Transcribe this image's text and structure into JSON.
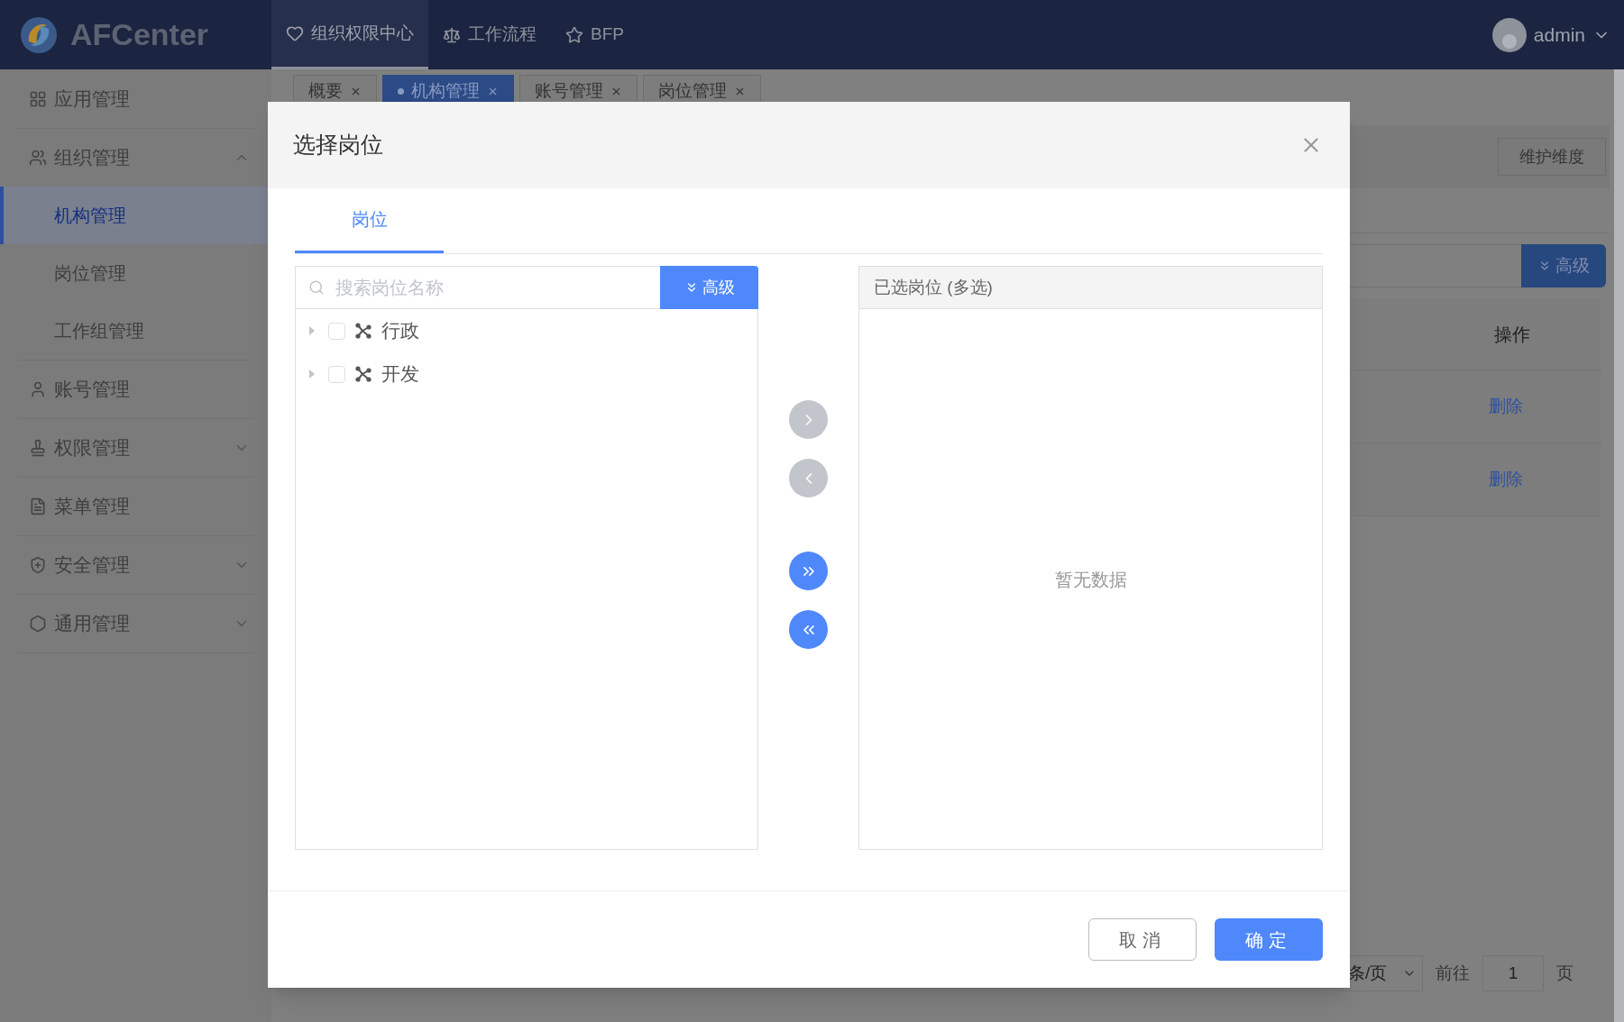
{
  "header": {
    "logo": "AFCenter",
    "nav": [
      {
        "label": "组织权限中心",
        "selected": true
      },
      {
        "label": "工作流程",
        "selected": false
      },
      {
        "label": "BFP",
        "selected": false
      }
    ],
    "user": "admin"
  },
  "sidebar": {
    "items": [
      {
        "label": "应用管理",
        "kind": "link"
      },
      {
        "label": "组织管理",
        "kind": "group",
        "expanded": true,
        "children": [
          {
            "label": "机构管理",
            "selected": true
          },
          {
            "label": "岗位管理",
            "selected": false
          },
          {
            "label": "工作组管理",
            "selected": false
          }
        ]
      },
      {
        "label": "账号管理",
        "kind": "link"
      },
      {
        "label": "权限管理",
        "kind": "group",
        "expanded": false
      },
      {
        "label": "菜单管理",
        "kind": "link"
      },
      {
        "label": "安全管理",
        "kind": "group",
        "expanded": false
      },
      {
        "label": "通用管理",
        "kind": "group",
        "expanded": false
      }
    ]
  },
  "tabs": [
    {
      "label": "概要",
      "selected": false
    },
    {
      "label": "机构管理",
      "selected": true
    },
    {
      "label": "账号管理",
      "selected": false
    },
    {
      "label": "岗位管理",
      "selected": false
    }
  ],
  "page": {
    "toolbar_button": "维护维度",
    "advanced_button": "高级",
    "table": {
      "columns": [
        "操作"
      ],
      "rows": [
        {
          "action": "删除"
        },
        {
          "action": "删除"
        }
      ]
    },
    "pagination": {
      "page_size": "条/页",
      "goto_label": "前往",
      "page": "1",
      "page_suffix": "页"
    }
  },
  "dialog": {
    "title": "选择岗位",
    "tabs": [
      {
        "label": "岗位",
        "selected": true
      }
    ],
    "search": {
      "placeholder": "搜索岗位名称",
      "advanced_button": "高级"
    },
    "tree": [
      {
        "label": "行政",
        "checked": false,
        "expanded": false
      },
      {
        "label": "开发",
        "checked": false,
        "expanded": false
      }
    ],
    "transfer_buttons": [
      {
        "kind": "right",
        "disabled": true
      },
      {
        "kind": "left",
        "disabled": true
      },
      {
        "kind": "all-right",
        "disabled": false
      },
      {
        "kind": "all-left",
        "disabled": false
      }
    ],
    "selected_panel": {
      "title": "已选岗位 (多选)",
      "empty_text": "暂无数据"
    },
    "buttons": [
      {
        "label": "取消",
        "kind": "default"
      },
      {
        "label": "确定",
        "kind": "primary"
      }
    ]
  }
}
